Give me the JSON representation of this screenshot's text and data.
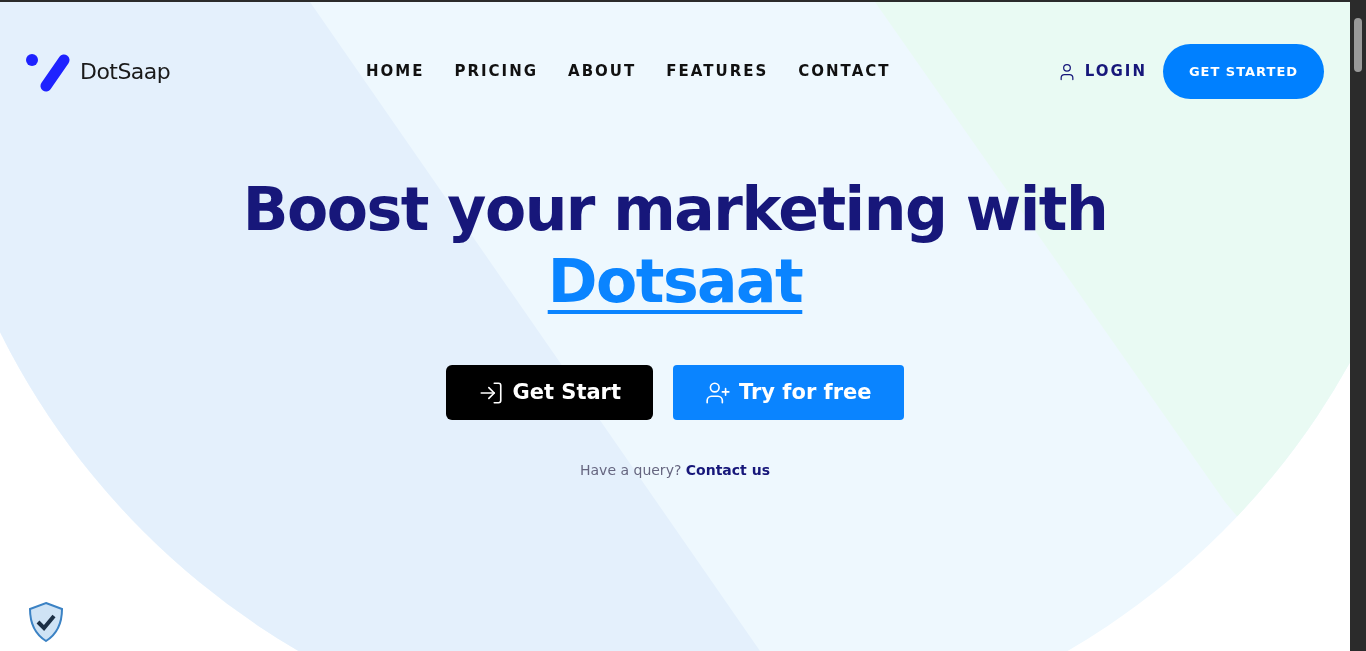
{
  "logo": {
    "text": "DotSaap"
  },
  "nav": [
    {
      "label": "HOME"
    },
    {
      "label": "PRICING"
    },
    {
      "label": "ABOUT"
    },
    {
      "label": "FEATURES"
    },
    {
      "label": "CONTACT"
    }
  ],
  "login": {
    "label": "LOGIN"
  },
  "cta": {
    "label": "GET STARTED"
  },
  "hero": {
    "title": "Boost your marketing with",
    "highlight": "Dotsaat"
  },
  "buttons": [
    {
      "kind": "primary",
      "label": "Get Start"
    },
    {
      "kind": "secondary",
      "label": "Try for free"
    }
  ],
  "query": {
    "text": "Have a query?",
    "link": "Contact us"
  }
}
